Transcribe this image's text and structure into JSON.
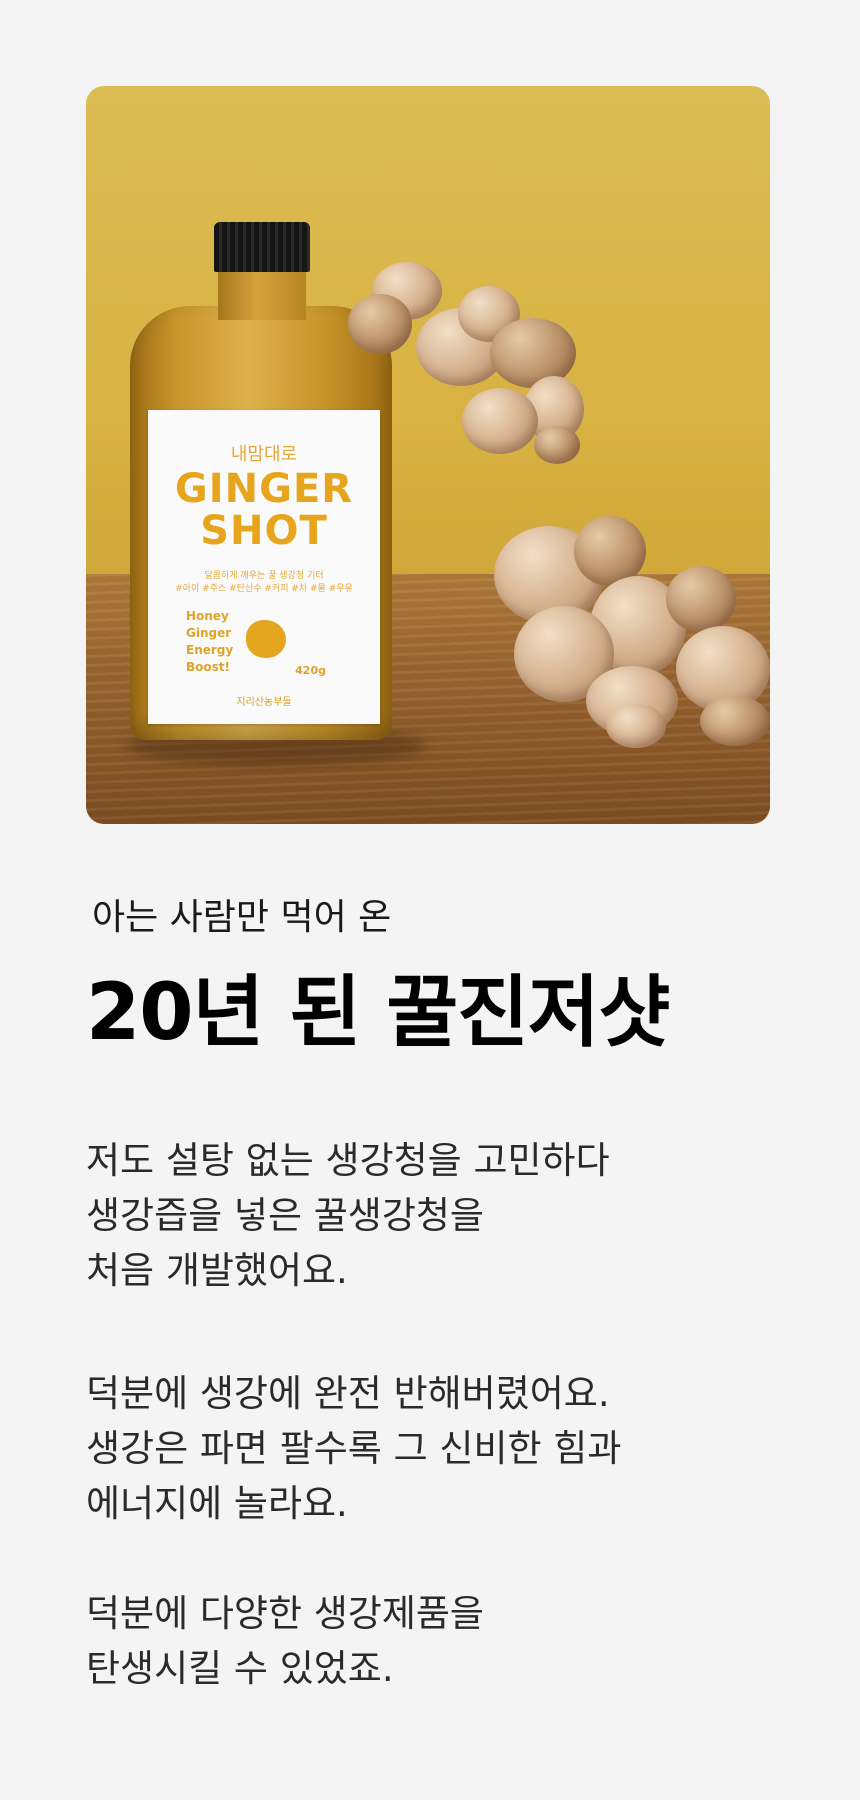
{
  "product_image": {
    "label": {
      "top_text": "내맘대로",
      "brand_line1": "GINGER",
      "brand_line2": "SHOT",
      "subline": "달콤하게 깨우는 꿀 생강청 기터",
      "tagline": "#아이 #주스 #탄산수 #커피 #차 #물 #우유",
      "desc": [
        "Honey",
        "Ginger",
        "Energy",
        "Boost!"
      ],
      "weight": "420g",
      "maker": "지리산농부들",
      "accent_color": "#e6a51c"
    },
    "background_color": "#d8b242"
  },
  "intro": {
    "subtitle": "아는 사람만 먹어 온",
    "title": "20년 된 꿀진저샷"
  },
  "paragraphs": [
    [
      "저도 설탕 없는 생강청을 고민하다",
      "생강즙을 넣은 꿀생강청을",
      "처음 개발했어요."
    ],
    [
      "덕분에 생강에 완전 반해버렸어요.",
      "생강은 파면 팔수록 그 신비한 힘과",
      "에너지에 놀라요."
    ],
    [
      "덕분에 다양한 생강제품을",
      "탄생시킬 수 있었죠."
    ]
  ]
}
